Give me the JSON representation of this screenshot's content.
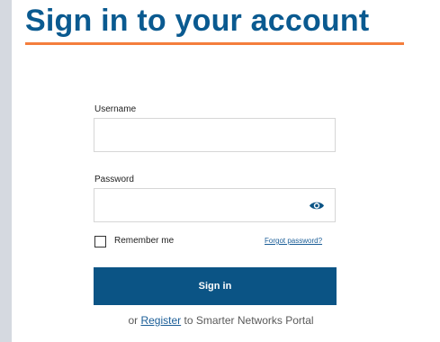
{
  "page": {
    "title": "Sign in to your account"
  },
  "form": {
    "username_label": "Username",
    "username_value": "",
    "password_label": "Password",
    "password_value": "",
    "remember_label": "Remember me",
    "remember_checked": false,
    "forgot_label": "Forgot password?",
    "signin_label": "Sign in"
  },
  "register": {
    "prefix": "or",
    "link_label": "Register",
    "suffix": "to Smarter Networks Portal"
  },
  "colors": {
    "brand_blue": "#0b5485",
    "title_blue": "#0a5a90",
    "accent_orange": "#f47e3c",
    "left_rail": "#d5d9e0"
  },
  "icons": {
    "password_toggle": "eye-icon"
  }
}
